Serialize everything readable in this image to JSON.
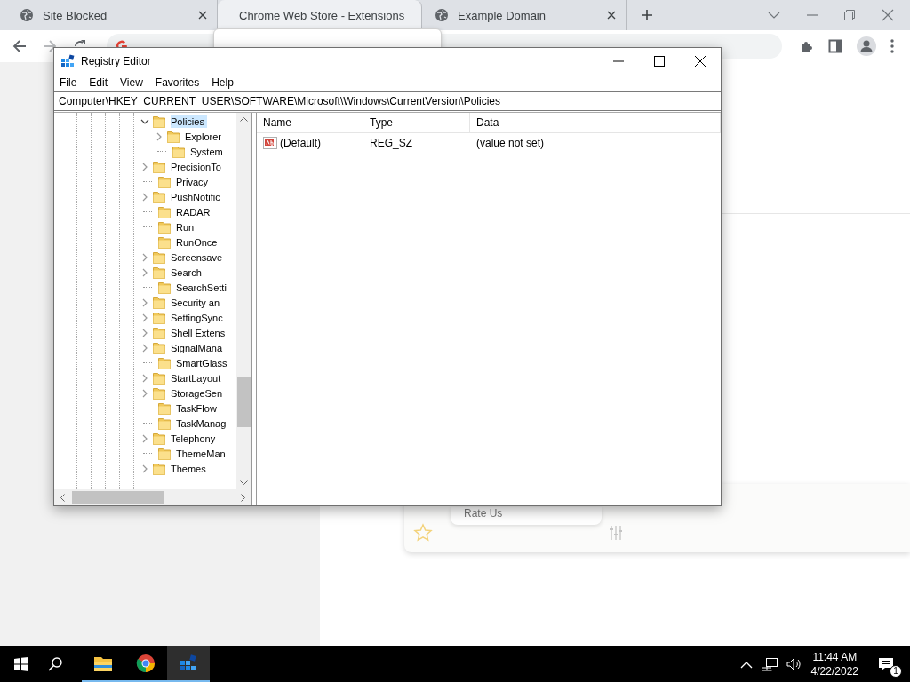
{
  "browser": {
    "tabs": [
      {
        "title": "Site Blocked",
        "selected": false
      },
      {
        "title": "Chrome Web Store - Extensions",
        "selected": true
      },
      {
        "title": "Example Domain",
        "selected": false
      }
    ],
    "page": {
      "menu_item": "Rate Us"
    }
  },
  "regedit": {
    "window": {
      "title": "Registry Editor"
    },
    "menu": [
      "File",
      "Edit",
      "View",
      "Favorites",
      "Help"
    ],
    "address": "Computer\\HKEY_CURRENT_USER\\SOFTWARE\\Microsoft\\Windows\\CurrentVersion\\Policies",
    "tree": [
      {
        "label": "Policies",
        "expandable": true,
        "expanded": true,
        "selected": true,
        "children": [
          {
            "label": "Explorer",
            "expandable": true,
            "expanded": false,
            "selected": false
          },
          {
            "label": "System",
            "expandable": false,
            "selected": false
          }
        ]
      },
      {
        "label": "PrecisionTo",
        "expandable": true,
        "expanded": false,
        "selected": false
      },
      {
        "label": "Privacy",
        "expandable": false,
        "selected": false
      },
      {
        "label": "PushNotific",
        "expandable": true,
        "expanded": false,
        "selected": false
      },
      {
        "label": "RADAR",
        "expandable": false,
        "selected": false
      },
      {
        "label": "Run",
        "expandable": false,
        "selected": false
      },
      {
        "label": "RunOnce",
        "expandable": false,
        "selected": false
      },
      {
        "label": "Screensave",
        "expandable": true,
        "expanded": false,
        "selected": false
      },
      {
        "label": "Search",
        "expandable": true,
        "expanded": false,
        "selected": false
      },
      {
        "label": "SearchSetti",
        "expandable": false,
        "selected": false
      },
      {
        "label": "Security an",
        "expandable": true,
        "expanded": false,
        "selected": false
      },
      {
        "label": "SettingSync",
        "expandable": true,
        "expanded": false,
        "selected": false
      },
      {
        "label": "Shell Extens",
        "expandable": true,
        "expanded": false,
        "selected": false
      },
      {
        "label": "SignalMana",
        "expandable": true,
        "expanded": false,
        "selected": false
      },
      {
        "label": "SmartGlass",
        "expandable": false,
        "selected": false
      },
      {
        "label": "StartLayout",
        "expandable": true,
        "expanded": false,
        "selected": false
      },
      {
        "label": "StorageSen",
        "expandable": true,
        "expanded": false,
        "selected": false
      },
      {
        "label": "TaskFlow",
        "expandable": false,
        "selected": false
      },
      {
        "label": "TaskManag",
        "expandable": false,
        "selected": false
      },
      {
        "label": "Telephony",
        "expandable": true,
        "expanded": false,
        "selected": false
      },
      {
        "label": "ThemeMan",
        "expandable": false,
        "selected": false
      },
      {
        "label": "Themes",
        "expandable": true,
        "expanded": false,
        "selected": false
      }
    ],
    "table": {
      "columns": [
        "Name",
        "Type",
        "Data"
      ],
      "rows": [
        {
          "name": "(Default)",
          "type": "REG_SZ",
          "data": "(value not set)"
        }
      ]
    }
  },
  "taskbar": {
    "apps": [
      {
        "kind": "explorer",
        "running": true,
        "selected": false
      },
      {
        "kind": "chrome",
        "running": true,
        "selected": false
      },
      {
        "kind": "regedit",
        "running": true,
        "selected": true
      }
    ],
    "time": "11:44 AM",
    "date": "4/22/2022",
    "notifications": "1"
  }
}
